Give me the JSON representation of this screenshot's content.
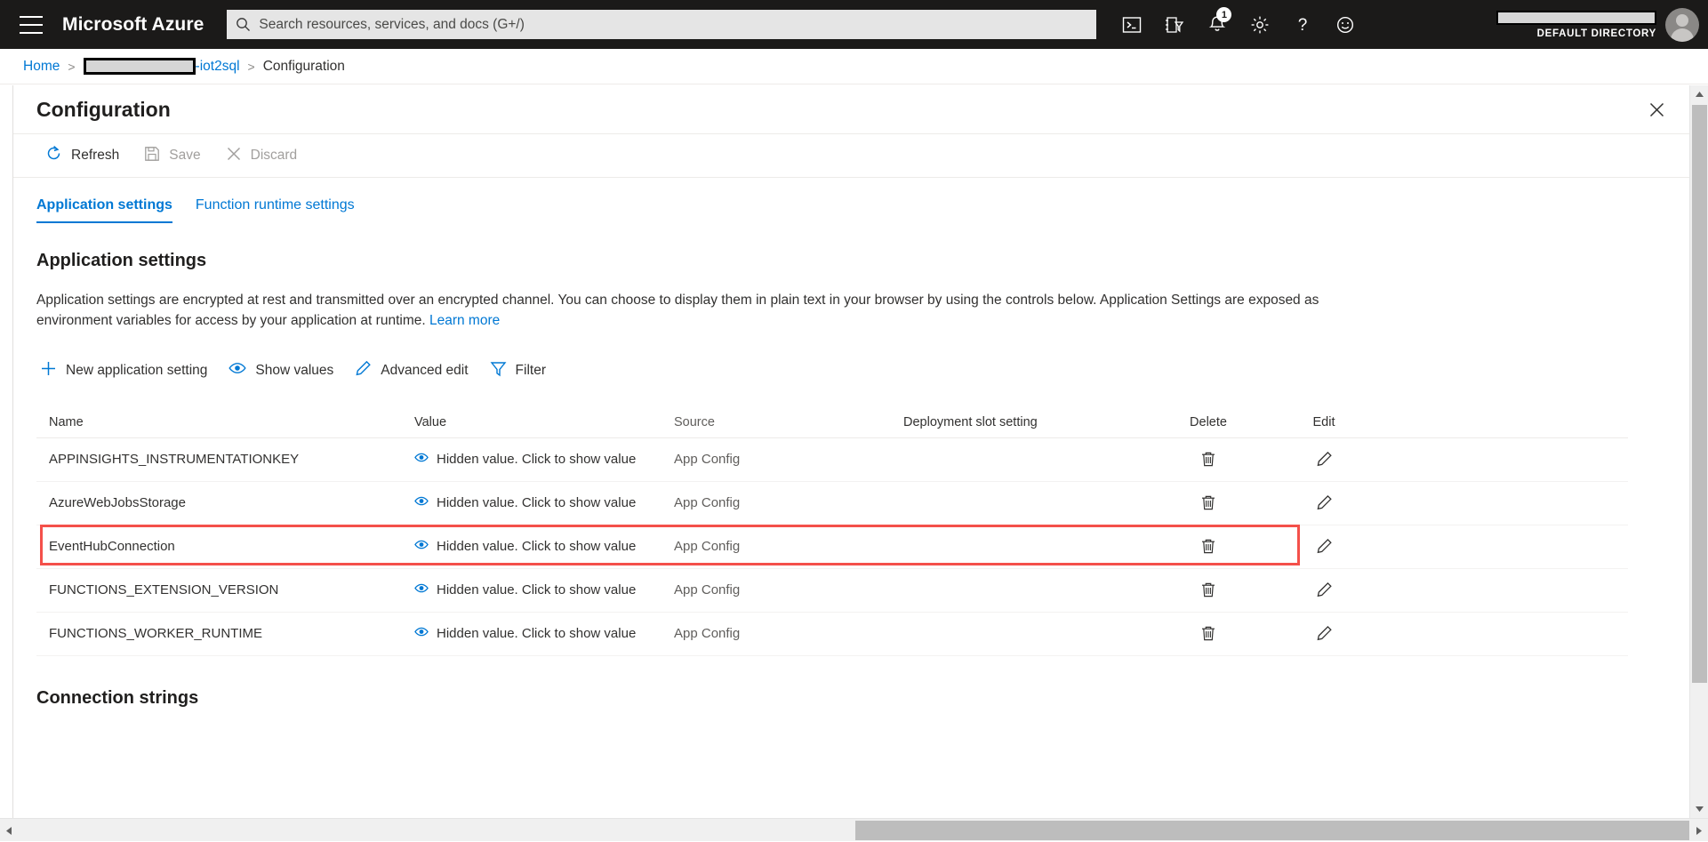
{
  "topbar": {
    "menu_label": "menu",
    "brand": "Microsoft Azure",
    "search_placeholder": "Search resources, services, and docs (G+/)",
    "search_value": "",
    "icons": [
      {
        "name": "cloud-shell-icon",
        "label": "Cloud Shell"
      },
      {
        "name": "directories-filter-icon",
        "label": "Directories + subscriptions"
      },
      {
        "name": "notifications-bell-icon",
        "label": "Notifications",
        "badge": "1"
      },
      {
        "name": "settings-gear-icon",
        "label": "Settings"
      },
      {
        "name": "help-question-icon",
        "label": "Help"
      },
      {
        "name": "feedback-smiley-icon",
        "label": "Feedback"
      }
    ],
    "account": {
      "name_redacted": "",
      "directory": "DEFAULT DIRECTORY"
    }
  },
  "breadcrumb": {
    "home": "Home",
    "separator": ">",
    "resource_redacted": "",
    "resource_suffix": "-iot2sql",
    "current": "Configuration"
  },
  "blade": {
    "title": "Configuration",
    "close_label": "Close"
  },
  "commandbar": {
    "refresh": "Refresh",
    "save": "Save",
    "discard": "Discard"
  },
  "tabs": [
    {
      "label": "Application settings",
      "active": true
    },
    {
      "label": "Function runtime settings",
      "active": false
    }
  ],
  "section": {
    "title": "Application settings",
    "description": "Application settings are encrypted at rest and transmitted over an encrypted channel. You can choose to display them in plain text in your browser by using the controls below. Application Settings are exposed as environment variables for access by your application at runtime.",
    "learn_more": "Learn more"
  },
  "actions": [
    {
      "name": "new-application-setting-button",
      "icon": "plus-icon",
      "label": "New application setting"
    },
    {
      "name": "show-values-button",
      "icon": "eye-icon",
      "label": "Show values"
    },
    {
      "name": "advanced-edit-button",
      "icon": "pencil-icon",
      "label": "Advanced edit"
    },
    {
      "name": "filter-button",
      "icon": "funnel-icon",
      "label": "Filter"
    }
  ],
  "table": {
    "headers": {
      "name": "Name",
      "value": "Value",
      "source": "Source",
      "slot": "Deployment slot setting",
      "delete": "Delete",
      "edit": "Edit"
    },
    "rows": [
      {
        "name": "APPINSIGHTS_INSTRUMENTATIONKEY",
        "value": "Hidden value. Click to show value",
        "source": "App Config",
        "slot": "",
        "highlighted": false
      },
      {
        "name": "AzureWebJobsStorage",
        "value": "Hidden value. Click to show value",
        "source": "App Config",
        "slot": "",
        "highlighted": false
      },
      {
        "name": "EventHubConnection",
        "value": "Hidden value. Click to show value",
        "source": "App Config",
        "slot": "",
        "highlighted": true
      },
      {
        "name": "FUNCTIONS_EXTENSION_VERSION",
        "value": "Hidden value. Click to show value",
        "source": "App Config",
        "slot": "",
        "highlighted": false
      },
      {
        "name": "FUNCTIONS_WORKER_RUNTIME",
        "value": "Hidden value. Click to show value",
        "source": "App Config",
        "slot": "",
        "highlighted": false
      }
    ]
  },
  "connection_strings": {
    "title": "Connection strings"
  },
  "colors": {
    "azure_blue": "#0078d4",
    "topbar_bg": "#1b1a19",
    "highlight_red": "#f4504a",
    "disabled_gray": "#a19f9d"
  }
}
